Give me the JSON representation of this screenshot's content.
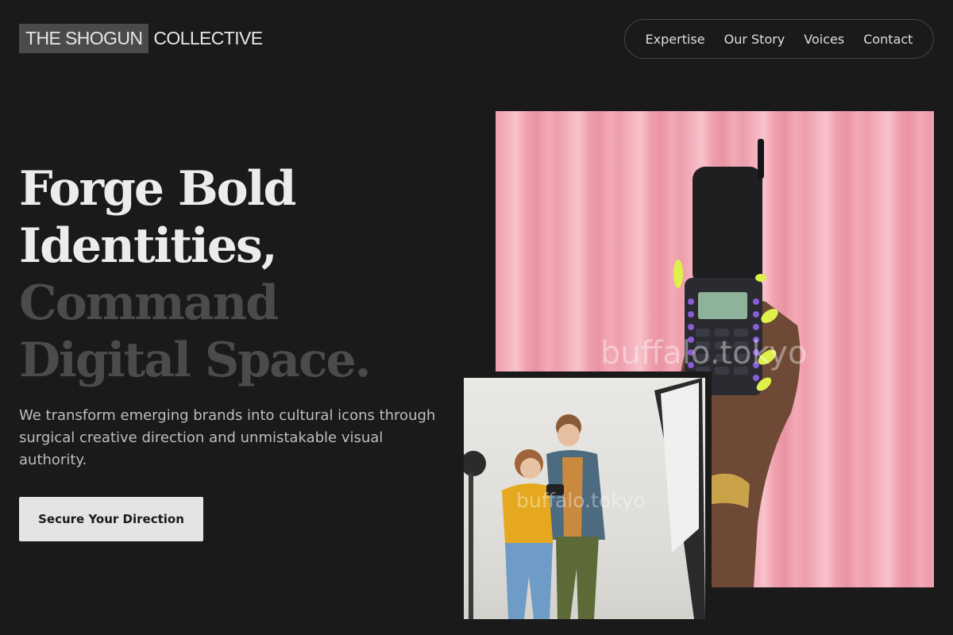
{
  "brand": {
    "highlight": "THE SHOGUN",
    "rest": "COLLECTIVE"
  },
  "nav": {
    "items": [
      "Expertise",
      "Our Story",
      "Voices",
      "Contact"
    ]
  },
  "hero": {
    "headline_light_1": "Forge Bold",
    "headline_light_2": "Identities,",
    "headline_dim_1": "Command",
    "headline_dim_2": "Digital Space.",
    "lede": "We transform emerging brands into cultural icons through surgical creative direction and unmistakable visual authority.",
    "cta_label": "Secure Your Direction"
  },
  "images": {
    "main_watermark": "buffalo.tokyo",
    "inset_watermark": "buffalo.tokyo",
    "main_subject": "hand-holding-flip-phone",
    "inset_subject": "two-people-photo-studio"
  },
  "colors": {
    "background": "#1a1a1a",
    "text_light": "#ececec",
    "text_dim": "#4b4b4b",
    "cta_bg": "#e4e4e4",
    "logo_mark_bg": "#4a4a4a",
    "curtain_pink": "#f1a8b4"
  }
}
